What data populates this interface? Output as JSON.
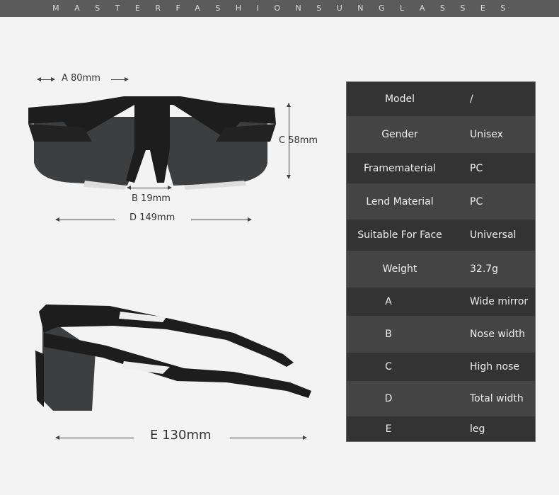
{
  "header": {
    "title": "MASTERFASHIONSUNGLASSES"
  },
  "dimensions": {
    "a": "A 80mm",
    "b": "B 19mm",
    "c": "C 58mm",
    "d": "D 149mm",
    "e": "E 130mm"
  },
  "specs": [
    {
      "key": "Model",
      "value": "/"
    },
    {
      "key": "Gender",
      "value": "Unisex"
    },
    {
      "key": "Framematerial",
      "value": "PC"
    },
    {
      "key": "Lend Material",
      "value": "PC"
    },
    {
      "key": "Suitable For Face",
      "value": "Universal"
    },
    {
      "key": "Weight",
      "value": "32.7g"
    },
    {
      "key": "A",
      "value": "Wide mirror"
    },
    {
      "key": "B",
      "value": "Nose width"
    },
    {
      "key": "C",
      "value": "High nose"
    },
    {
      "key": "D",
      "value": "Total width"
    },
    {
      "key": "E",
      "value": "leg"
    }
  ]
}
